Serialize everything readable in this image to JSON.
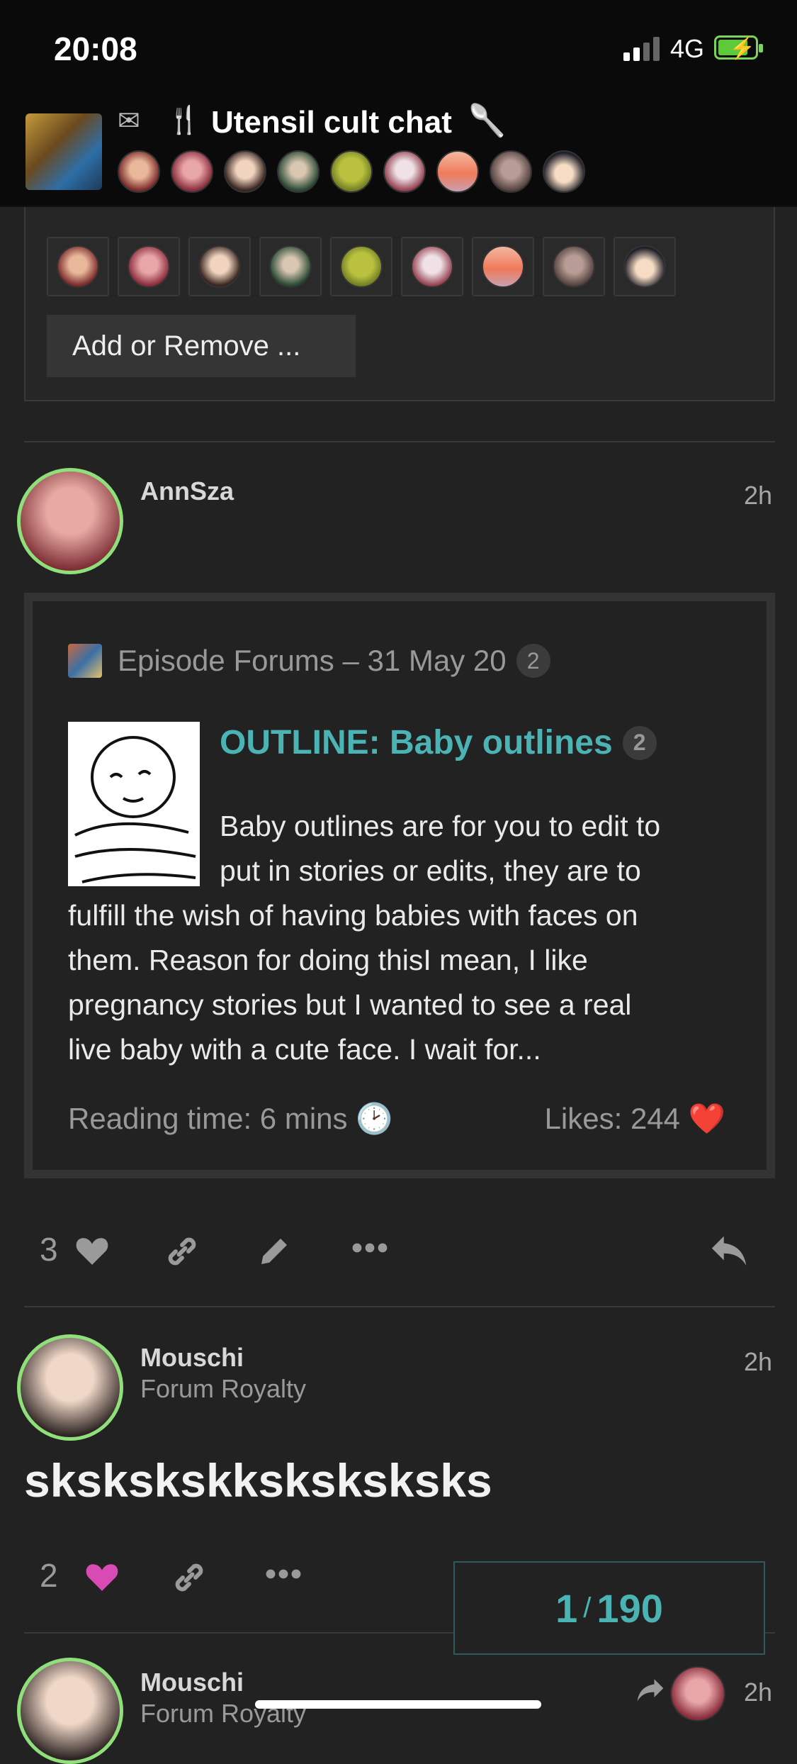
{
  "status": {
    "time": "20:08",
    "network": "4G"
  },
  "header": {
    "title": "Utensil cult chat"
  },
  "panel": {
    "add_remove": "Add or Remove ..."
  },
  "post1": {
    "username": "AnnSza",
    "age": "2h",
    "onebox": {
      "source": "Episode Forums – 31 May 20",
      "source_badge": "2",
      "title": "OUTLINE: Baby outlines",
      "title_badge": "2",
      "body_lines": [
        "Baby outlines are for you to edit to",
        "put in stories or edits, they are to",
        "fulfill the wish of having babies with faces on",
        "them. Reason for doing thisI mean, I like",
        "pregnancy stories but I wanted to see a real",
        "live baby with a cute face. I wait for..."
      ],
      "reading_time": "Reading time: 6 mins",
      "likes": "Likes: 244"
    },
    "like_count": "3"
  },
  "post2": {
    "username": "Mouschi",
    "user_title": "Forum Royalty",
    "age": "2h",
    "body": "sksksksk​ksksksksks",
    "like_count": "2"
  },
  "post3": {
    "username": "Mouschi",
    "user_title": "Forum Royalty",
    "age": "2h"
  },
  "progress": {
    "current": "1",
    "total": "190"
  },
  "colors": {
    "accent": "#4bb3b3",
    "avatar_ring": "#8fe07a",
    "liked": "#d94bb4",
    "heart_red": "#e53a2e"
  }
}
